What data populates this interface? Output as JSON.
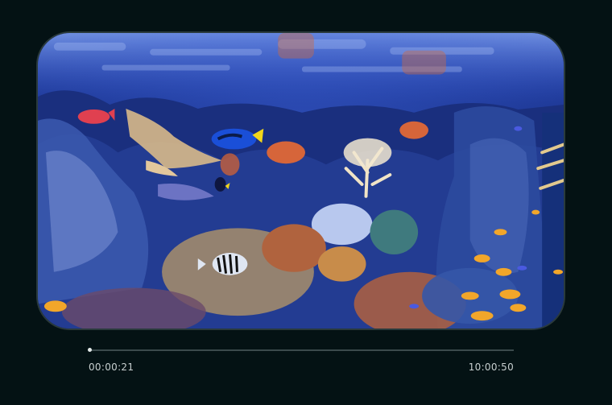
{
  "player": {
    "current_time": "00:00:21",
    "total_time": "10:00:50",
    "progress_fraction": 0.0006
  },
  "colors": {
    "background": "#041214",
    "track": "#3b4a4c",
    "fill": "#cfd6d6",
    "time_text": "#c8d0d0"
  }
}
